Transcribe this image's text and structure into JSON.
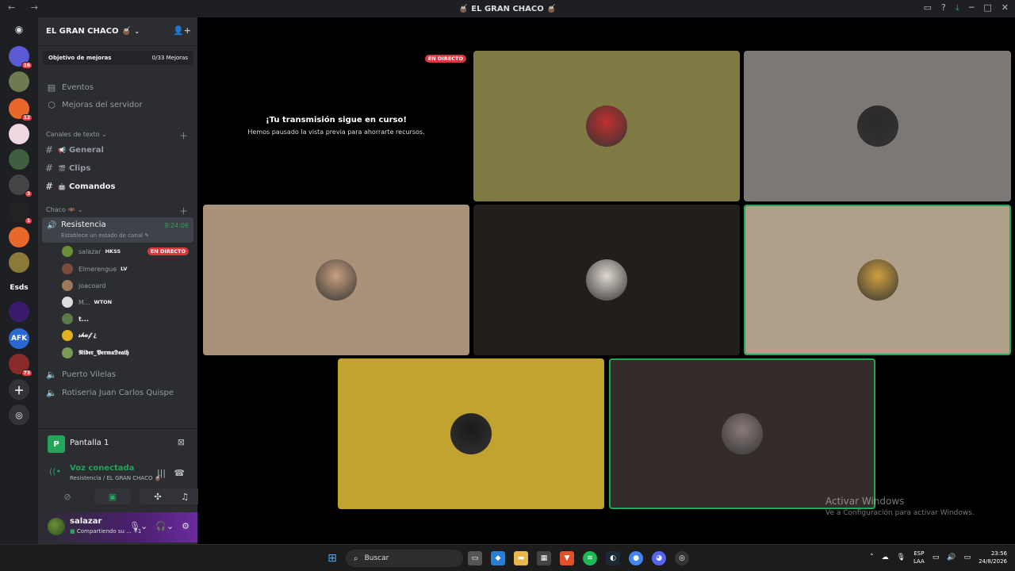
{
  "window": {
    "title": "🧉 EL GRAN CHACO 🧉",
    "nav": "← →",
    "icons": [
      "inbox-icon",
      "help-icon",
      "download-icon",
      "minimize-icon",
      "maximize-icon",
      "close-icon"
    ]
  },
  "servers": [
    {
      "badge": "16",
      "color": "#5b5bd6"
    },
    {
      "badge": "",
      "color": "#6d7a52"
    },
    {
      "badge": "12",
      "color": "#e8672a"
    },
    {
      "badge": "",
      "color": "#f0d6e0"
    },
    {
      "badge": "",
      "color": "#3f5f40"
    },
    {
      "badge": "3",
      "color": "#444"
    },
    {
      "badge": "1",
      "color": "#222"
    },
    {
      "badge": "",
      "color": "#e8672a"
    },
    {
      "badge": "",
      "color": "#8b7a3a"
    },
    {
      "label": "Esds",
      "badge": "",
      "color": "#1e1f22"
    },
    {
      "badge": "",
      "color": "#3a1a6b"
    },
    {
      "label": "AFK",
      "badge": "",
      "color": "#2a6ad0"
    },
    {
      "badge": "73",
      "color": "#8b2a2a"
    }
  ],
  "guild": {
    "name": "EL GRAN CHACO 🧉",
    "boost_label": "Objetivo de mejoras",
    "boost_value": "0/33 Mejoras"
  },
  "menu": [
    {
      "label": "Eventos"
    },
    {
      "label": "Mejoras del servidor"
    }
  ],
  "text_category": "Canales de texto",
  "text_channels": [
    {
      "emoji": "📢",
      "label": "General"
    },
    {
      "emoji": "🎬",
      "label": "Clips"
    },
    {
      "emoji": "🤖",
      "label": "Comandos"
    }
  ],
  "voice_category": "Chaco 🦇",
  "active_voice": {
    "name": "Resistencia",
    "status": "Establece un estado de canal",
    "time": "9:24:06"
  },
  "voice_users": [
    {
      "name": "salazar",
      "tag": "HKSS",
      "live": "EN DIRECTO",
      "color": "#6b8e3a"
    },
    {
      "name": "Elmerengue",
      "tag": "LV",
      "live": "",
      "color": "#7a4a3a"
    },
    {
      "name": "joacoard",
      "tag": "",
      "live": "",
      "color": "#9a7a5a"
    },
    {
      "name": "M...",
      "tag": "WTON",
      "live": "",
      "color": "#ddd"
    },
    {
      "name": "t...",
      "tag": "",
      "live": "",
      "color": "#5a7a4a"
    },
    {
      "name": "𝓈𝒽𝓊𝒻 ¿",
      "tag": "",
      "live": "",
      "color": "#e0b020"
    },
    {
      "name": "𝕹𝖎𝖉𝖊𝖗_𝕻𝖊𝖗𝖒𝖆𝕯𝖊𝖆𝖙𝖍",
      "tag": "",
      "live": "",
      "color": "#7a9a5a"
    }
  ],
  "other_voice": [
    {
      "label": "Puerto Vilelas"
    },
    {
      "label": "Rotiseria Juan Carlos Quispe"
    }
  ],
  "screen_share": {
    "letter": "P",
    "label": "Pantalla 1"
  },
  "voice_connection": {
    "title": "Voz conectada",
    "subtitle": "Resistencia / EL GRAN CHACO 🧉"
  },
  "user": {
    "name": "salazar",
    "status": "Compartiendo su ...",
    "extra": "+1"
  },
  "stream": {
    "live": "EN DIRECTO",
    "heading": "¡Tu transmisión sigue en curso!",
    "subtext": "Hemos pausado la vista previa para ahorrarte recursos."
  },
  "tiles": [
    {
      "bg": "#7f7a43",
      "avatar": "#c03030"
    },
    {
      "bg": "#7b7875",
      "avatar": "#2a2a2a"
    },
    {
      "bg": "#a8927a",
      "avatar": "#c8a080"
    },
    {
      "bg": "#221e1c",
      "avatar": "#e0d8d0"
    },
    {
      "bg": "#b09f89",
      "avatar": "#d0a040",
      "speaking": true
    },
    {
      "bg": "#c3a330",
      "avatar": "#1a1a1a"
    },
    {
      "bg": "#332c2b",
      "avatar": "#8a7a7a",
      "speaking": true
    }
  ],
  "watermark": {
    "title": "Activar Windows",
    "subtitle": "Ve a Configuración para activar Windows."
  },
  "taskbar": {
    "search": "Buscar",
    "lang_top": "ESP",
    "lang_bottom": "LAA",
    "time": "23:56",
    "date": "24/8/2026"
  }
}
